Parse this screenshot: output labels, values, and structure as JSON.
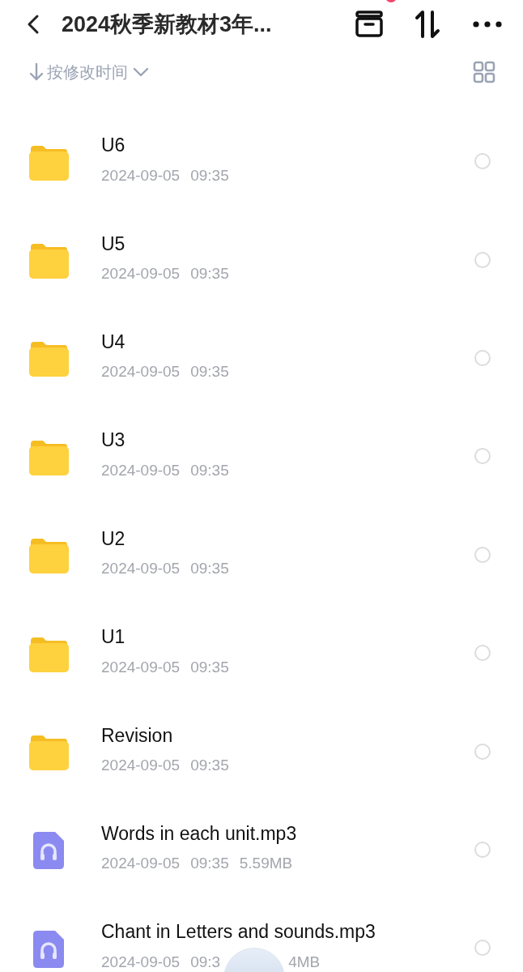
{
  "header": {
    "title": "2024秋季新教材3年...",
    "has_notification": true
  },
  "sort_bar": {
    "label": "按修改时间"
  },
  "items": [
    {
      "kind": "folder",
      "name": "U6",
      "meta": [
        "2024-09-05",
        "09:35"
      ],
      "selected": false
    },
    {
      "kind": "folder",
      "name": "U5",
      "meta": [
        "2024-09-05",
        "09:35"
      ],
      "selected": false
    },
    {
      "kind": "folder",
      "name": "U4",
      "meta": [
        "2024-09-05",
        "09:35"
      ],
      "selected": false
    },
    {
      "kind": "folder",
      "name": "U3",
      "meta": [
        "2024-09-05",
        "09:35"
      ],
      "selected": false
    },
    {
      "kind": "folder",
      "name": "U2",
      "meta": [
        "2024-09-05",
        "09:35"
      ],
      "selected": false
    },
    {
      "kind": "folder",
      "name": "U1",
      "meta": [
        "2024-09-05",
        "09:35"
      ],
      "selected": false
    },
    {
      "kind": "folder",
      "name": "Revision",
      "meta": [
        "2024-09-05",
        "09:35"
      ],
      "selected": false
    },
    {
      "kind": "audio",
      "name": "Words in each unit.mp3",
      "meta": [
        "2024-09-05",
        "09:35",
        "5.59MB"
      ],
      "selected": false
    },
    {
      "kind": "audio",
      "name": "Chant in Letters and sounds.mp3",
      "meta": [
        "2024-09-05",
        "09:3",
        "4MB"
      ],
      "selected": false
    }
  ]
}
